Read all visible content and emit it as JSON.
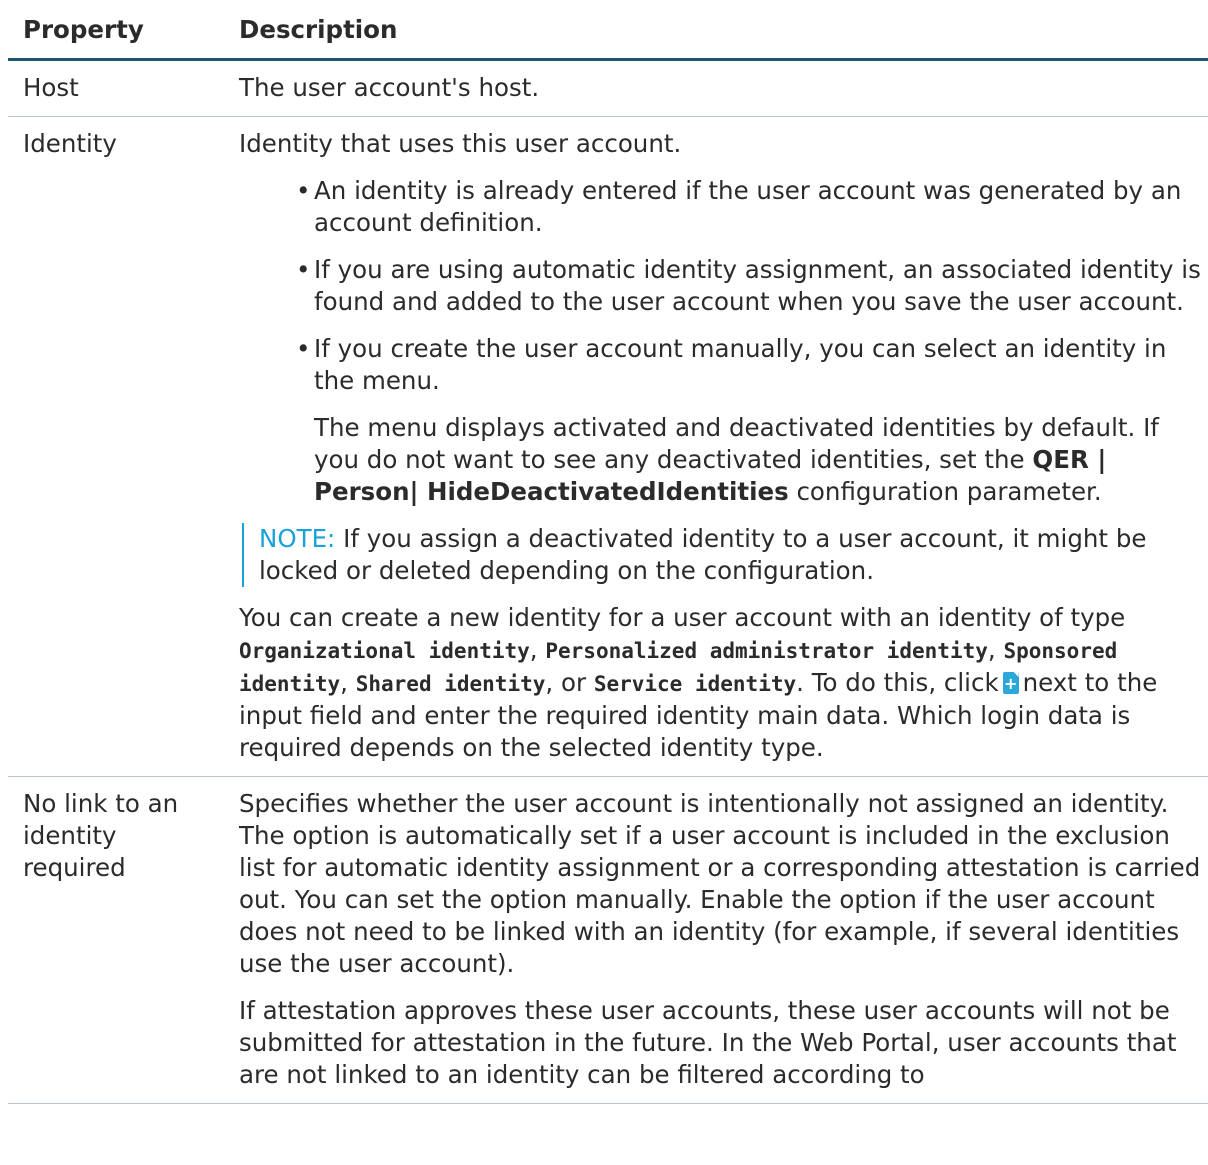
{
  "table": {
    "headers": {
      "property": "Property",
      "description": "Description"
    },
    "rows": {
      "host": {
        "property": "Host",
        "description": "The user account's host."
      },
      "identity": {
        "property": "Identity",
        "intro": "Identity that uses this user account.",
        "bullets": [
          "An identity is already entered if the user account was generated by an account definition.",
          "If you are using automatic identity assignment, an associated identity is found and added to the user account when you save the user account.",
          "If you create the user account manually, you can select an identity in the menu."
        ],
        "menu_text_before": "The menu displays activated and deactivated identities by default. If you do not want to see any deactivated identities, set the ",
        "menu_param": "QER | Person| HideDeactivatedIdentities",
        "menu_text_after": " configuration parameter.",
        "note_label": "NOTE:",
        "note_text": " If you assign a deactivated identity to a user account, it might be locked or deleted depending on the configuration.",
        "create_text_1": "You can create a new identity for a user account with an identity of type ",
        "type_organizational": "Organizational identity",
        "sep_1": ", ",
        "type_personalized": "Personalized administrator identity",
        "sep_2": ", ",
        "type_sponsored": "Sponsored identity",
        "sep_3": ", ",
        "type_shared": "Shared identity",
        "sep_4": ", or ",
        "type_service": "Service identity",
        "create_text_2": ". To do this, click",
        "create_text_3": "next to the input field and enter the required identity main data. Which login data is required depends on the selected identity type."
      },
      "no_link": {
        "property": "No link to an identity required",
        "para_1": "Specifies whether the user account is intentionally not assigned an identity. The option is automatically set if a user account is included in the exclusion list for automatic identity assignment or a corresponding attestation is carried out. You can set the option manually. Enable the option if the user account does not need to be linked with an identity (for example, if several identities use the user account).",
        "para_2": "If attestation approves these user accounts, these user accounts will not be submitted for attestation in the future. In the Web Portal, user accounts that are not linked to an identity can be filtered according to"
      }
    }
  },
  "colors": {
    "header_rule": "#20556f",
    "note_accent": "#1aa2d8",
    "icon_fill": "#2ba7d9",
    "text": "#2b2b2b"
  },
  "icons": {
    "new_identity": "add-document-icon"
  }
}
